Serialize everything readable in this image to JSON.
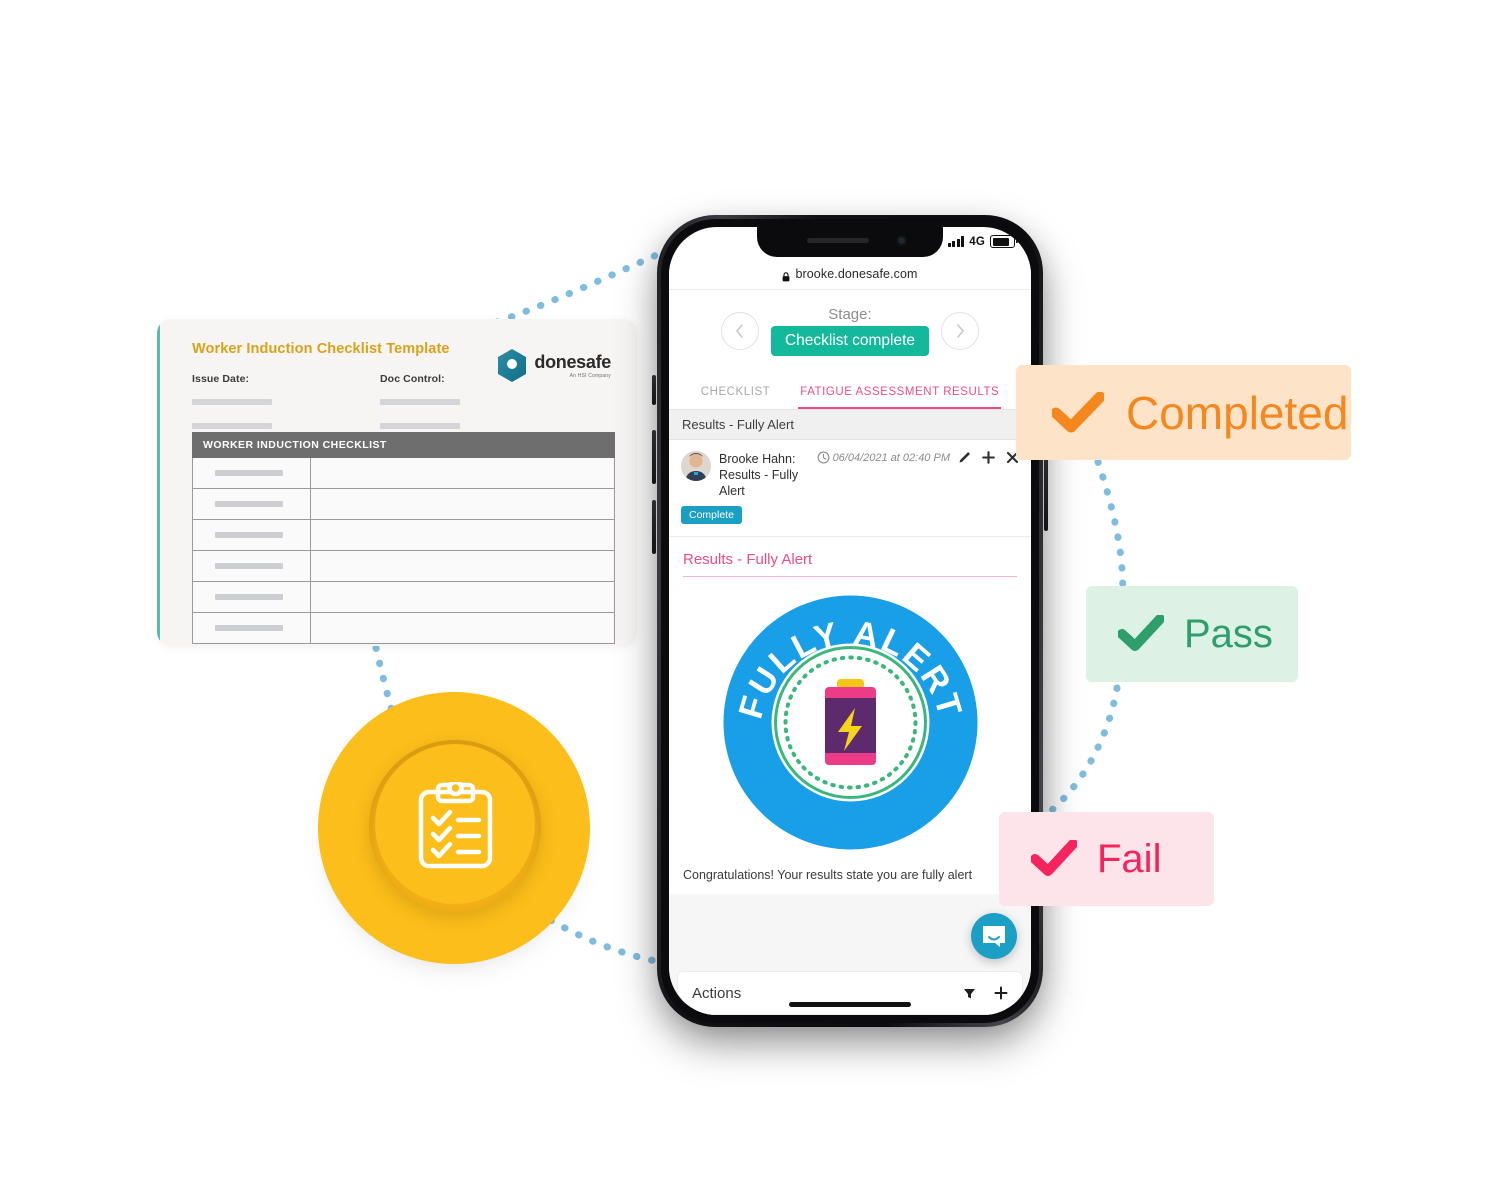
{
  "document_card": {
    "title": "Worker Induction Checklist Template",
    "fields": [
      {
        "label": "Issue Date:"
      },
      {
        "label": "Doc Control:"
      }
    ],
    "logo": {
      "name": "donesafe",
      "tagline": "An HSI Company"
    },
    "table": {
      "header": "WORKER INDUCTION CHECKLIST",
      "row_count": 6
    }
  },
  "icon_badge": {
    "icon": "clipboard-checklist-icon",
    "color": "#fbbe1a"
  },
  "phone": {
    "status_bar": {
      "network": "4G",
      "signal_bars": 4,
      "battery_level": "full"
    },
    "browser": {
      "url": "brooke.donesafe.com",
      "secure_icon": "lock-icon"
    },
    "stage": {
      "label": "Stage:",
      "value": "Checklist complete",
      "prev_icon": "chevron-left-icon",
      "next_icon": "chevron-right-icon",
      "accent": "#14b89a"
    },
    "tabs": [
      {
        "label": "CHECKLIST",
        "active": false
      },
      {
        "label": "FATIGUE ASSESSMENT RESULTS",
        "active": true
      }
    ],
    "section_header": "Results - Fully Alert",
    "entry": {
      "author": "Brooke Hahn:",
      "subject": "Results - Fully Alert",
      "timestamp": "06/04/2021 at 02:40 PM",
      "status_chip": "Complete",
      "actions": [
        "edit-icon",
        "add-icon",
        "close-icon"
      ]
    },
    "result": {
      "title": "Results - Fully Alert",
      "emblem_text": "FULLY ALERT",
      "emblem_icon": "battery-lightning-icon",
      "message": "Congratulations! Your results state you are fully alert"
    },
    "actions_bar": {
      "label": "Actions",
      "filter_icon": "filter-icon",
      "add_icon": "plus-icon"
    },
    "intercom": {
      "icon": "chat-bubble-icon"
    }
  },
  "callouts": [
    {
      "label": "Completed",
      "icon": "check-icon",
      "bg": "#fde3c8",
      "fg": "#f4881f"
    },
    {
      "label": "Pass",
      "icon": "check-icon",
      "bg": "#ddf2e4",
      "fg": "#2e9e6b"
    },
    {
      "label": "Fail",
      "icon": "check-icon",
      "bg": "#fde4ea",
      "fg": "#f5245e"
    }
  ]
}
